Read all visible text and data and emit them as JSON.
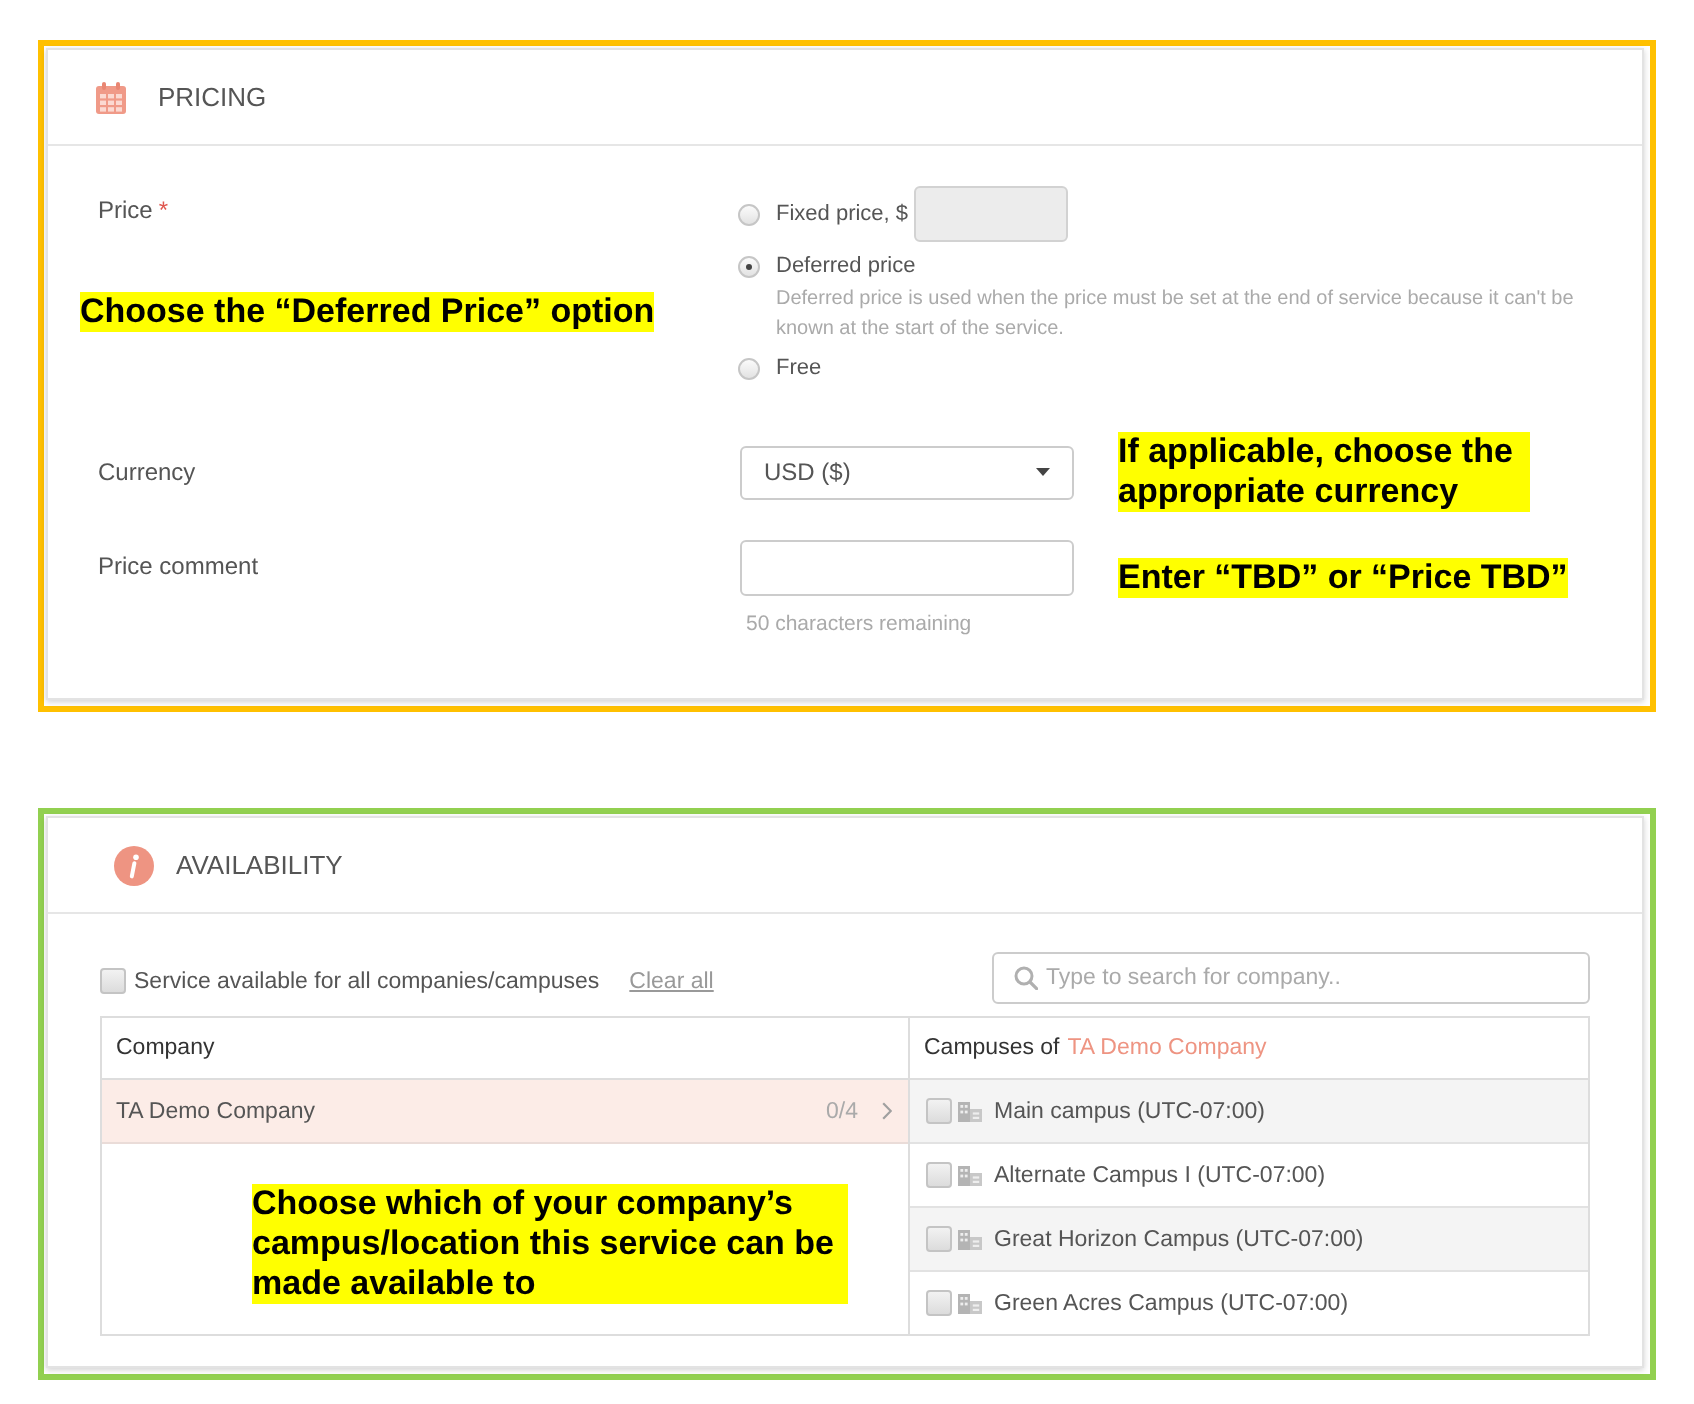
{
  "pricing": {
    "title": "PRICING",
    "price": {
      "label": "Price",
      "required_mark": "*",
      "callout": "Choose the “Deferred Price” option",
      "options": [
        {
          "kind": "amount",
          "label": "Fixed price, $",
          "selected": false,
          "input_disabled": true
        },
        {
          "kind": "plain",
          "label": "Deferred price",
          "selected": true,
          "description": "Deferred price is used when the price must be set at the end of service because it can't be known at the start of the service."
        },
        {
          "kind": "plain",
          "label": "Free",
          "selected": false
        }
      ]
    },
    "currency": {
      "label": "Currency",
      "value": "USD ($)",
      "callout": "If applicable, choose the appropriate currency"
    },
    "price_comment": {
      "label": "Price comment",
      "counter": "50 characters remaining",
      "callout": "Enter “TBD” or “Price TBD”"
    }
  },
  "availability": {
    "title": "AVAILABILITY",
    "all_campuses": {
      "label": "Service available for all companies/campuses",
      "checked": false
    },
    "clear_link": "Clear all",
    "search": {
      "placeholder": "Type to search for company.."
    },
    "companies": {
      "heading": "Company",
      "rows": [
        {
          "name": "TA Demo Company",
          "count": "0/4",
          "selected": true
        }
      ],
      "callout": "Choose which of your company’s campus/location this service can be made available to"
    },
    "campuses": {
      "heading": "Campuses of",
      "company": "TA Demo Company",
      "rows": [
        {
          "name": "Main campus (UTC-07:00)",
          "checked": false
        },
        {
          "name": "Alternate Campus I (UTC-07:00)",
          "checked": false
        },
        {
          "name": "Great Horizon Campus (UTC-07:00)",
          "checked": false
        },
        {
          "name": "Green Acres Campus (UTC-07:00)",
          "checked": false
        }
      ]
    }
  }
}
